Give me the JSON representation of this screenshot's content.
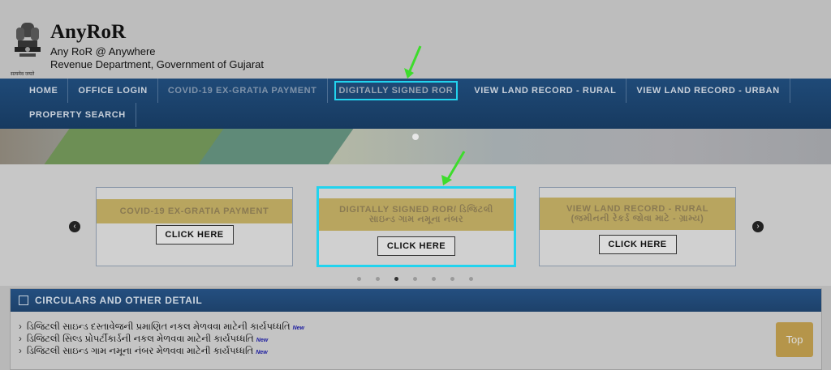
{
  "header": {
    "emblem_caption": "सत्यमेव जयते",
    "title": "AnyRoR",
    "subtitle1": "Any RoR @ Anywhere",
    "subtitle2": "Revenue Department, Government of Gujarat"
  },
  "nav": {
    "items": [
      {
        "label": "HOME"
      },
      {
        "label": "OFFICE LOGIN"
      },
      {
        "label": "COVID-19 EX-GRATIA PAYMENT"
      },
      {
        "label": "DIGITALLY SIGNED ROR"
      },
      {
        "label": "VIEW LAND RECORD - RURAL"
      },
      {
        "label": "VIEW LAND RECORD - URBAN"
      },
      {
        "label": "PROPERTY SEARCH"
      }
    ]
  },
  "carousel": {
    "cards": [
      {
        "title": "COVID-19 EX-GRATIA PAYMENT",
        "button": "CLICK HERE"
      },
      {
        "title_line1": "DIGITALLY SIGNED ROR/ ડિજિટલી",
        "title_line2": "સાઇન્ડ ગામ નમૂના નંબર",
        "button": "CLICK HERE"
      },
      {
        "title_line1": "VIEW LAND RECORD - RURAL",
        "title_line2": "(જમીનની રેકર્ડ જોવા માટે - ગ્રામ્ય)",
        "button": "CLICK HERE"
      }
    ],
    "prev_symbol": "‹",
    "next_symbol": "›"
  },
  "circulars": {
    "heading": "CIRCULARS AND OTHER DETAIL",
    "items": [
      {
        "text": "ડિજિટલી સાઇન્ડ દસ્તાવેજની પ્રમાણિત નકલ મેળવવા માટેની કાર્યપધ્ધતિ",
        "badge": "New"
      },
      {
        "text": "ડિજિટલી સિલ્ડ પ્રોપર્ટીકાર્ડની નકલ મેળવવા માટેની કાર્યપધ્ધતિ",
        "badge": "New"
      },
      {
        "text": "ડિજિટલી સાઇન્ડ ગામ નમૂના નંબર મેળવવા માટેની કાર્યપધ્ધતિ",
        "badge": "New"
      }
    ]
  },
  "top_button": "Top",
  "colors": {
    "highlight": "#22d3ee",
    "annotation_arrow": "#3ddc2c",
    "nav_bg": "#1f4a78"
  }
}
